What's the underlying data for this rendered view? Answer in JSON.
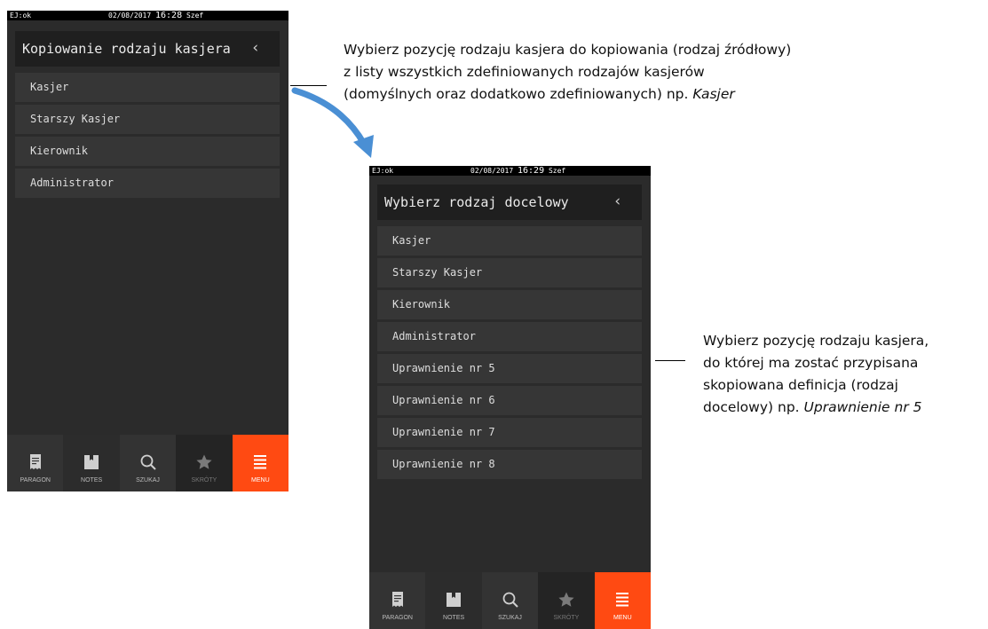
{
  "screen1": {
    "status": {
      "ej": "EJ:ok",
      "date": "02/08/2017",
      "time": "16:28",
      "user": "Szef"
    },
    "title": "Kopiowanie rodzaju kasjera",
    "back_icon": "chevron-left-icon",
    "items": [
      "Kasjer",
      "Starszy Kasjer",
      "Kierownik",
      "Administrator"
    ],
    "nav": [
      {
        "label": "PARAGON",
        "icon": "receipt-icon"
      },
      {
        "label": "NOTES",
        "icon": "notebook-icon"
      },
      {
        "label": "SZUKAJ",
        "icon": "search-icon"
      },
      {
        "label": "SKRÓTY",
        "icon": "star-icon"
      },
      {
        "label": "MENU",
        "icon": "menu-icon"
      }
    ]
  },
  "screen2": {
    "status": {
      "ej": "EJ:ok",
      "date": "02/08/2017",
      "time": "16:29",
      "user": "Szef"
    },
    "title": "Wybierz rodzaj docelowy",
    "back_icon": "chevron-left-icon",
    "items": [
      "Kasjer",
      "Starszy Kasjer",
      "Kierownik",
      "Administrator",
      "Uprawnienie nr 5",
      "Uprawnienie nr 6",
      "Uprawnienie nr 7",
      "Uprawnienie nr 8"
    ],
    "nav": [
      {
        "label": "PARAGON",
        "icon": "receipt-icon"
      },
      {
        "label": "NOTES",
        "icon": "notebook-icon"
      },
      {
        "label": "SZUKAJ",
        "icon": "search-icon"
      },
      {
        "label": "SKRÓTY",
        "icon": "star-icon"
      },
      {
        "label": "MENU",
        "icon": "menu-icon"
      }
    ]
  },
  "annotation1": {
    "line1": "Wybierz pozycję rodzaju kasjera do kopiowania (rodzaj źródłowy)",
    "line2": "z listy wszystkich zdefiniowanych rodzajów kasjerów",
    "line3": "(domyślnych oraz dodatkowo zdefiniowanych) np. ",
    "line3_italic": "Kasjer"
  },
  "annotation2": {
    "line1": "Wybierz pozycję rodzaju kasjera,",
    "line2": "do której ma zostać przypisana",
    "line3": "skopiowana definicja (rodzaj",
    "line4": "docelowy) np. ",
    "line4_italic": "Uprawnienie nr 5"
  },
  "colors": {
    "accent": "#ff4a12",
    "arrow": "#4a8fd4",
    "panel": "#2b2b2b",
    "item": "#363636"
  }
}
